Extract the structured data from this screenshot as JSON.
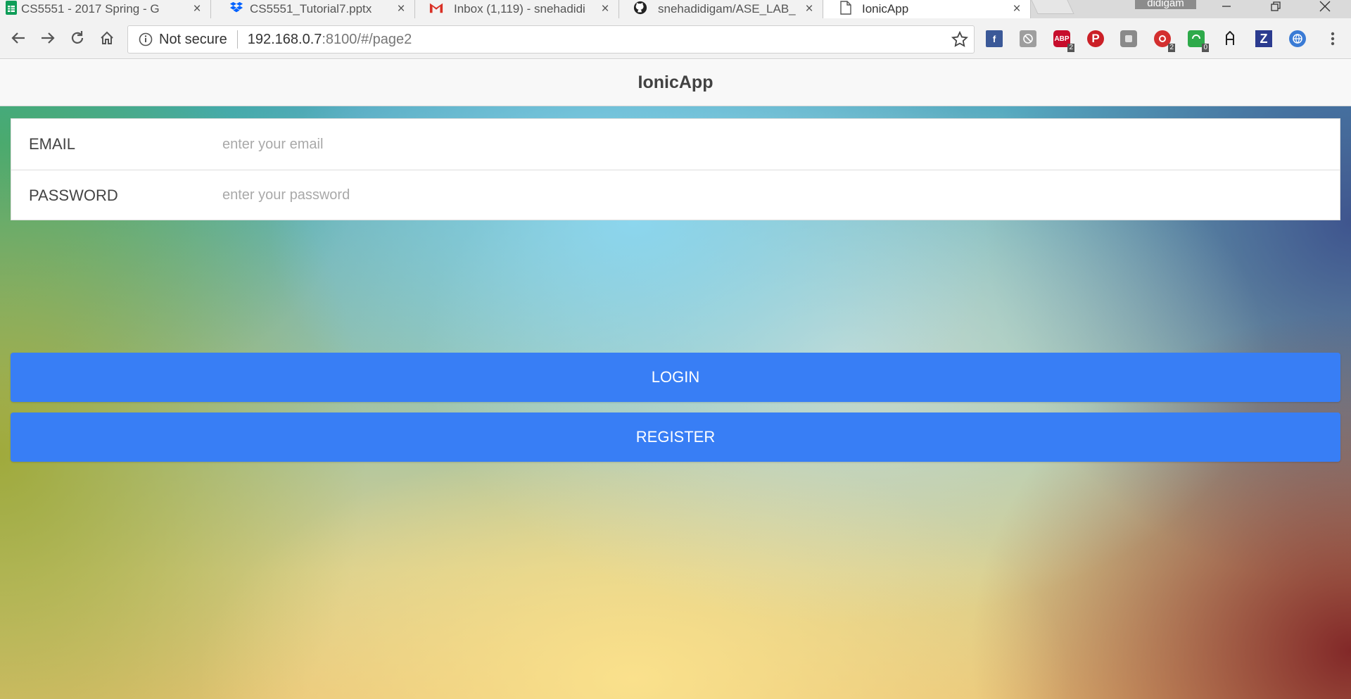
{
  "browser": {
    "tabs": [
      {
        "title": "CS5551 - 2017 Spring - G",
        "favicon": "sheets-icon"
      },
      {
        "title": "CS5551_Tutorial7.pptx",
        "favicon": "dropbox-icon"
      },
      {
        "title": "Inbox (1,119) - snehadidi",
        "favicon": "gmail-icon"
      },
      {
        "title": "snehadidigam/ASE_LAB_",
        "favicon": "github-icon"
      },
      {
        "title": "IonicApp",
        "favicon": "page-icon"
      }
    ],
    "active_tab": 4,
    "profile_name": "didigam",
    "address_bar": {
      "security_label": "Not secure",
      "host": "192.168.0.7",
      "url_rest": ":8100/#/page2"
    },
    "extensions": [
      {
        "name": "facebook-icon",
        "color": "#3b5998",
        "badge": ""
      },
      {
        "name": "extension-gray-icon",
        "color": "#9e9e9e",
        "badge": ""
      },
      {
        "name": "adblock-plus-icon",
        "color": "#c70d2c",
        "badge": "2"
      },
      {
        "name": "pinterest-icon",
        "color": "#cb2027",
        "badge": ""
      },
      {
        "name": "extension-gray2-icon",
        "color": "#8a8a8a",
        "badge": ""
      },
      {
        "name": "red-extension-icon",
        "color": "#d32f2f",
        "badge": "2"
      },
      {
        "name": "green-extension-icon",
        "color": "#2eaa4a",
        "badge": "0"
      },
      {
        "name": "feather-icon",
        "color": "#222222",
        "badge": ""
      },
      {
        "name": "zotero-icon",
        "color": "#2b3b8f",
        "badge": ""
      },
      {
        "name": "globe-extension-icon",
        "color": "#3a7bd5",
        "badge": ""
      }
    ]
  },
  "app": {
    "title": "IonicApp",
    "form": {
      "email_label": "EMAIL",
      "email_placeholder": "enter your email",
      "email_value": "",
      "password_label": "PASSWORD",
      "password_placeholder": "enter your password",
      "password_value": ""
    },
    "login_label": "LOGIN",
    "register_label": "REGISTER",
    "accent_color": "#387ef5"
  }
}
